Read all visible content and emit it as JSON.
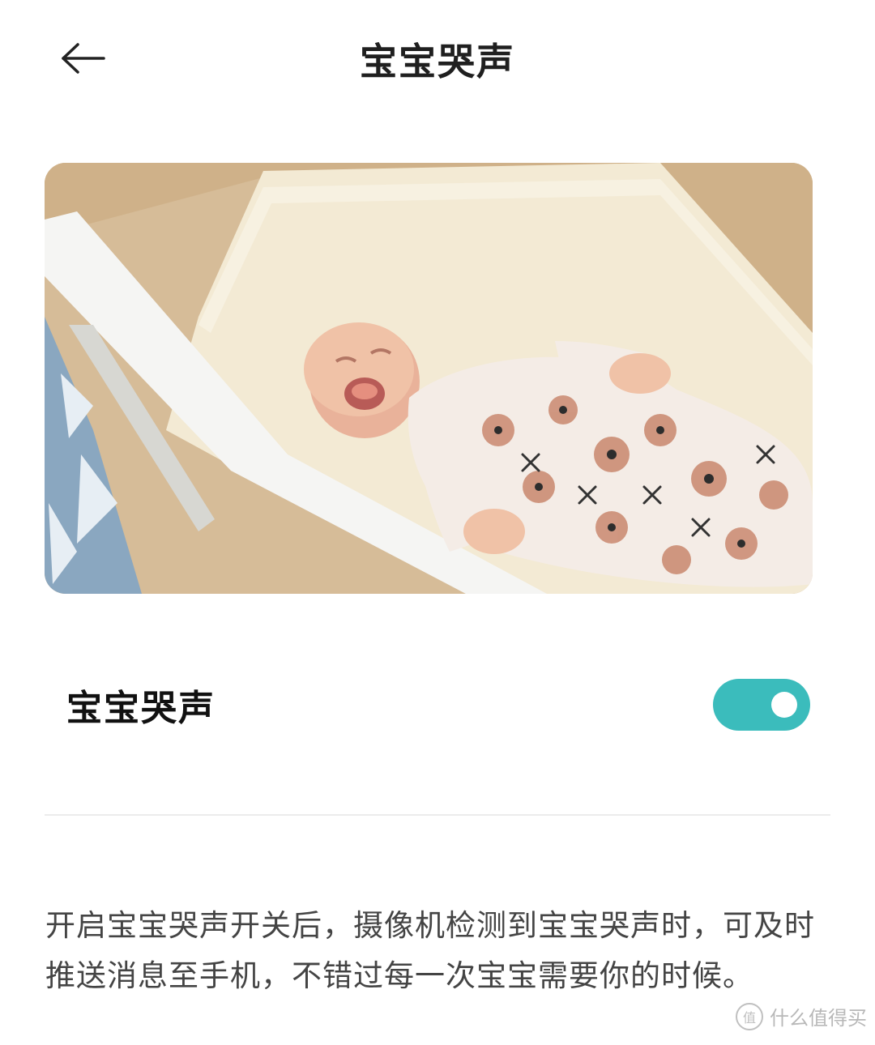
{
  "header": {
    "title": "宝宝哭声",
    "back_icon": "arrow-left-icon"
  },
  "hero": {
    "alt": "crying-baby-photo"
  },
  "setting": {
    "label": "宝宝哭声",
    "toggle_on": true,
    "toggle_color": "#3bbcbc"
  },
  "description": "开启宝宝哭声开关后，摄像机检测到宝宝哭声时，可及时推送消息至手机，不错过每一次宝宝需要你的时候。",
  "watermark": {
    "logo": "值",
    "text": "什么值得买"
  }
}
